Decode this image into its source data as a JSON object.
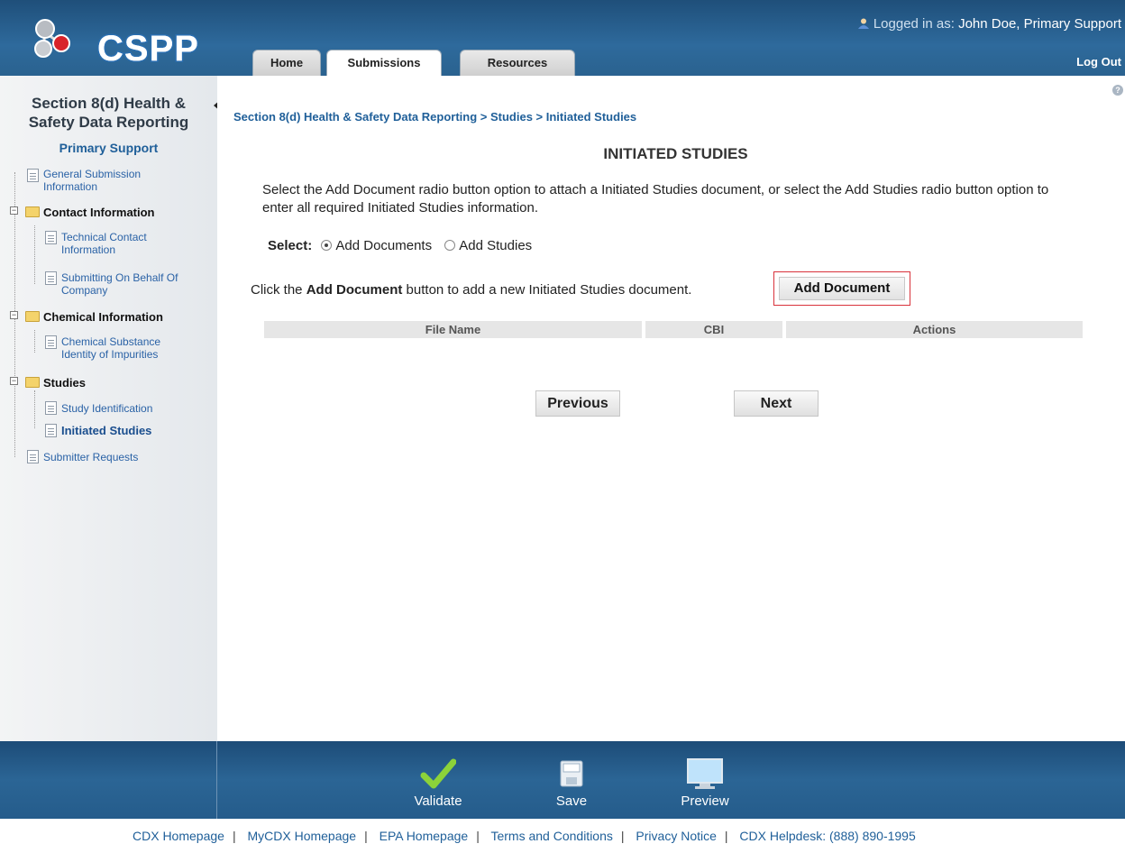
{
  "app": {
    "logo_text": "CSPP"
  },
  "header": {
    "tabs": [
      {
        "label": "Home"
      },
      {
        "label": "Submissions"
      },
      {
        "label": "Resources"
      }
    ],
    "login_prefix": "Logged in as:",
    "login_name": "John Doe, Primary Support",
    "logout": "Log Out"
  },
  "sidebar": {
    "title_line1": "Section 8(d) Health &",
    "title_line2": "Safety Data Reporting",
    "role": "Primary Support",
    "items": [
      {
        "line1": "General Submission",
        "line2": "Information"
      },
      {
        "label": "Contact Information"
      },
      {
        "line1": "Technical Contact",
        "line2": "Information"
      },
      {
        "line1": "Submitting On Behalf Of",
        "line2": "Company"
      },
      {
        "label": "Chemical Information"
      },
      {
        "line1": "Chemical Substance",
        "line2": "Identity of Impurities"
      },
      {
        "label": "Studies"
      },
      {
        "label": "Study Identification"
      },
      {
        "label": "Initiated Studies"
      },
      {
        "label": "Submitter Requests"
      }
    ]
  },
  "main": {
    "breadcrumb": "Section 8(d) Health & Safety Data Reporting > Studies > Initiated Studies",
    "title": "INITIATED STUDIES",
    "instructions": "Select the Add Document radio button option to attach a Initiated Studies document, or select the Add Studies radio button option to enter all required Initiated Studies information.",
    "select_label": "Select:",
    "radio_documents": "Add Documents",
    "radio_studies": "Add Studies",
    "selected_option": "Add Documents",
    "click_prefix": "Click the",
    "click_bold": "Add Document",
    "click_suffix": "button to add a new Initiated Studies document.",
    "add_document_button": "Add Document",
    "table_headers": [
      "File Name",
      "CBI",
      "Actions"
    ],
    "previous": "Previous",
    "next": "Next"
  },
  "footer_bar": {
    "validate": "Validate",
    "save": "Save",
    "preview": "Preview"
  },
  "footer_links": [
    "CDX Homepage",
    "MyCDX Homepage",
    "EPA Homepage",
    "Terms and Conditions",
    "Privacy Notice",
    "CDX Helpdesk: (888) 890-1995"
  ],
  "colors": {
    "header_blue": "#2a628f",
    "link_blue": "#1f5f99",
    "highlight_red": "#d9323b"
  }
}
